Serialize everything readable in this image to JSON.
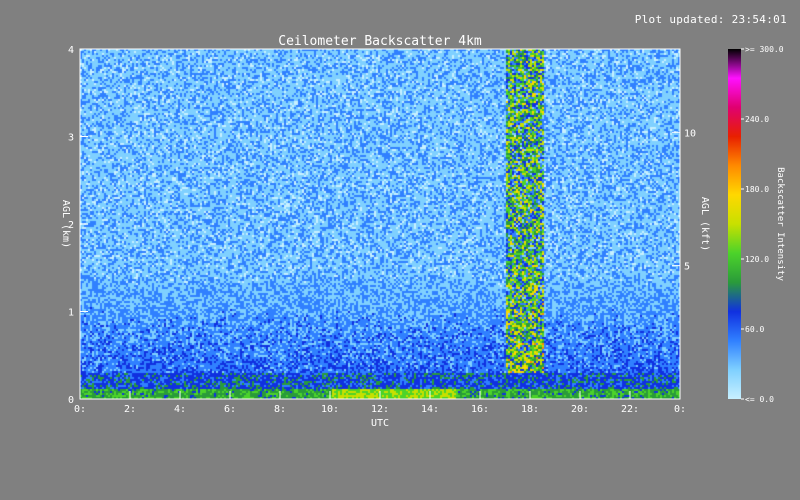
{
  "header": {
    "updated_text": "Plot updated: 23:54:01"
  },
  "chart_data": {
    "type": "heatmap",
    "title": "Ceilometer Backscatter 4km",
    "xlabel": "UTC",
    "ylabel": "AGL (km)",
    "ylabel_right": "AGL (kft)",
    "xlim": [
      0,
      24
    ],
    "ylim": [
      0,
      4
    ],
    "x_ticks": [
      0,
      2,
      4,
      6,
      8,
      10,
      12,
      14,
      16,
      18,
      20,
      22,
      24
    ],
    "x_tick_labels": [
      "0:",
      "2:",
      "4:",
      "6:",
      "8:",
      "10:",
      "12:",
      "14:",
      "16:",
      "18:",
      "20:",
      "22:",
      "0:"
    ],
    "y_ticks": [
      0,
      1,
      2,
      3,
      4
    ],
    "y_tick_labels": [
      "0",
      "1",
      "2",
      "3",
      "4"
    ],
    "y_right_ticks_kft": [
      5,
      10
    ],
    "y_right_tick_labels": [
      "5",
      "10"
    ],
    "colorbar": {
      "label": "Backscatter Intensity",
      "range": [
        0,
        300
      ],
      "ticks": [
        0,
        60,
        120,
        180,
        240,
        300
      ],
      "tick_labels": [
        "<= 0.0",
        "60.0",
        "120.0",
        "180.0",
        "240.0",
        ">= 300.0"
      ],
      "colors": [
        "#c8f0ff",
        "#7fd0ff",
        "#3080ff",
        "#1030e0",
        "#2a9b3a",
        "#4cd32a",
        "#c8e000",
        "#ffd800",
        "#ff8a00",
        "#e82000",
        "#e00070",
        "#ff10ff",
        "#000000"
      ]
    },
    "features": {
      "surface_layer_top_km": 0.3,
      "high_intensity_columns_hours": [
        [
          17.0,
          18.5
        ]
      ]
    }
  }
}
